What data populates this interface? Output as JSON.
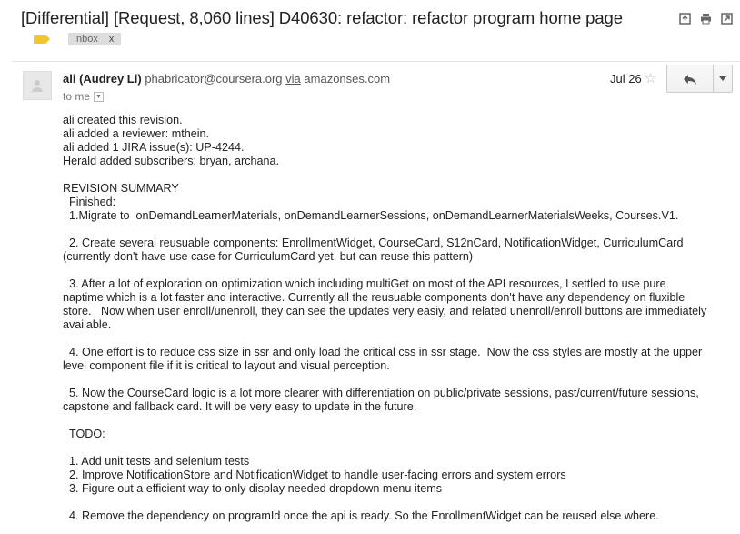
{
  "subject": "[Differential] [Request, 8,060 lines] D40630: refactor: refactor program home page",
  "labels": {
    "inbox": "Inbox",
    "inbox_remove": "x"
  },
  "toolbar_icons": [
    "archive-icon",
    "print-icon",
    "new-window-icon"
  ],
  "message": {
    "sender_name": "ali (Audrey Li)",
    "sender_email": "phabricator@coursera.org",
    "via_label": "via",
    "via_domain": "amazonses.com",
    "to_text": "to me",
    "date": "Jul 26",
    "body_lines": [
      "ali created this revision.",
      "ali added a reviewer: mthein.",
      "ali added 1 JIRA issue(s): UP-4244.",
      "Herald added subscribers: bryan, archana.",
      "",
      "REVISION SUMMARY",
      "  Finished:",
      "  1.Migrate to  onDemandLearnerMaterials, onDemandLearnerSessions, onDemandLearnerMaterialsWeeks, Courses.V1.",
      "",
      "  2. Create several reusuable components: EnrollmentWidget, CourseCard, S12nCard, NotificationWidget, CurriculumCard",
      "(currently don't have use case for CurriculumCard yet, but can reuse this pattern)",
      "",
      "  3. After a lot of exploration on optimization which including multiGet on most of the API resources, I settled to use pure",
      "naptime which is a lot faster and interactive. Currently all the reusuable components don't have any dependency on fluxible",
      "store.   Now when user enroll/unenroll, they can see the updates very easiy, and related unenroll/enroll buttons are immediately",
      "available.",
      "",
      "  4. One effort is to reduce css size in ssr and only load the critical css in ssr stage.  Now the css styles are mostly at the upper",
      "level component file if it is critical to layout and visual perception.",
      "",
      "  5. Now the CourseCard logic is a lot more clearer with differentiation on public/private sessions, past/current/future sessions,",
      "capstone and fallback card. It will be very easy to update in the future.",
      "",
      "  TODO:",
      "",
      "  1. Add unit tests and selenium tests",
      "  2. Improve NotificationStore and NotificationWidget to handle user-facing errors and system errors",
      "  3. Figure out a efficient way to only display needed dropdown menu items",
      "",
      "  4. Remove the dependency on programId once the api is ready. So the EnrollmentWidget can be reused else where."
    ]
  }
}
